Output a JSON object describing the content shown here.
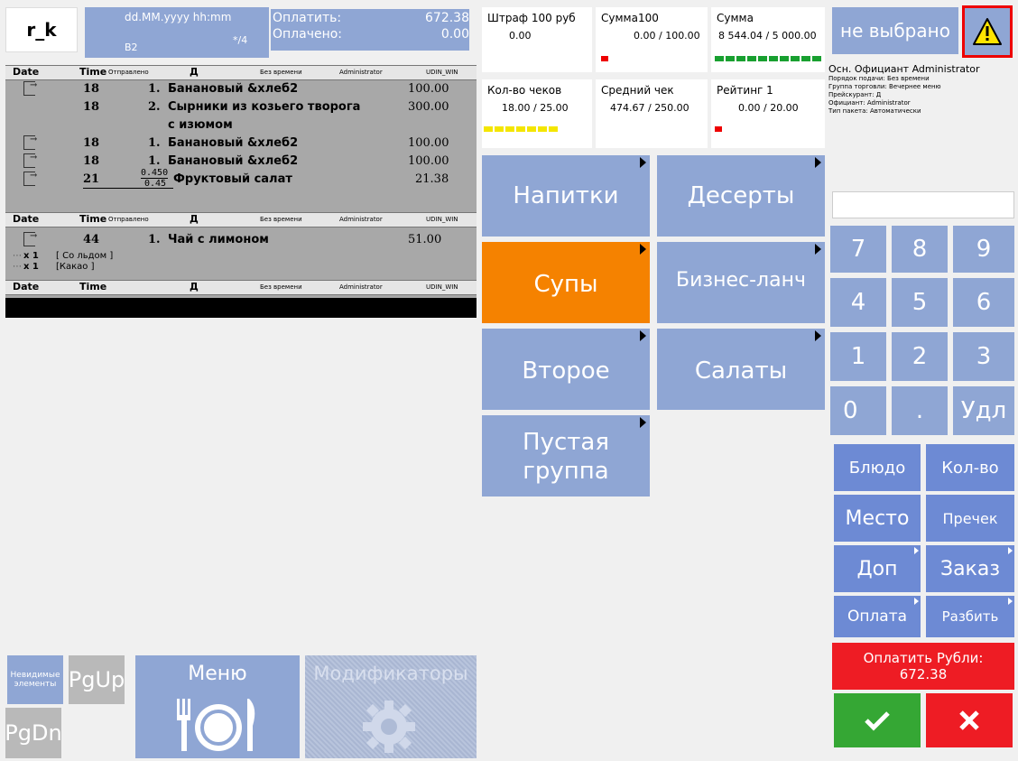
{
  "header": {
    "logo": "r_k",
    "date_format": "dd.MM.yyyy hh:mm",
    "table": "B2",
    "guests": "*/4",
    "pay_label": "Оплатить:",
    "pay_value": "672.38",
    "paid_label": "Оплачено:",
    "paid_value": "0.00"
  },
  "order": {
    "col_date": "Date",
    "col_time": "Time",
    "col_sent": "Отправлено",
    "col_d": "Д",
    "col_notime": "Без времени",
    "col_admin": "Administrator",
    "col_station": "UDIN_WIN",
    "lines": [
      {
        "time": "18",
        "num": "1.",
        "name": "Банановый &хлеб2",
        "price": "100.00"
      },
      {
        "time": "18",
        "num": "2.",
        "name": "Сырники из козьего творога",
        "price": "300.00"
      },
      {
        "name2": "с изюмом"
      },
      {
        "time": "18",
        "num": "1.",
        "name": "Банановый &хлеб2",
        "price": "100.00"
      },
      {
        "time": "18",
        "num": "1.",
        "name": "Банановый &хлеб2",
        "price": "100.00"
      },
      {
        "time": "21",
        "qty_top": "0.450",
        "qty_bot": "0.45",
        "name": "Фруктовый салат",
        "price": "21.38"
      },
      {
        "time": "44",
        "num": "1.",
        "name": "Чай с лимоном",
        "price": "51.00"
      }
    ],
    "modifiers": [
      {
        "qty": "x 1",
        "name": "[ Со льдом ]"
      },
      {
        "qty": "x 1",
        "name": "[Какао ]"
      }
    ]
  },
  "bottom_left": {
    "invisible": "Невидимые элементы",
    "pgup": "PgUp",
    "pgdn": "PgDn",
    "menu": "Меню",
    "modifiers": "Модификаторы"
  },
  "stats": [
    {
      "title": "Штраф 100 руб",
      "value": "0.00"
    },
    {
      "title": "Сумма100",
      "value": "0.00 / 100.00"
    },
    {
      "title": "Сумма",
      "value": "8 544.04 / 5 000.00"
    },
    {
      "title": "Кол-во чеков",
      "value": "18.00 / 25.00"
    },
    {
      "title": "Средний чек",
      "value": "474.67 / 250.00"
    },
    {
      "title": "Рейтинг 1",
      "value": "0.00 / 20.00"
    }
  ],
  "categories": [
    {
      "label": "Напитки"
    },
    {
      "label": "Десерты"
    },
    {
      "label": "Супы"
    },
    {
      "label": "Бизнес-ланч"
    },
    {
      "label": "Второе"
    },
    {
      "label": "Салаты"
    },
    {
      "label": "Пустая группа"
    }
  ],
  "right": {
    "waiter": "не выбрано",
    "info_main": "Осн. Официант  Administrator",
    "info_order": "Порядок подачи: Без времени",
    "info_group": "Группа торговли: Вечернее меню",
    "info_price": "Прейскурант: Д",
    "info_waiter": "Официант: Administrator",
    "info_pack": "Тип пакета: Автоматически",
    "keys": [
      "7",
      "8",
      "9",
      "4",
      "5",
      "6",
      "1",
      "2",
      "3",
      "0",
      ".",
      "Удл"
    ],
    "dish": "Блюдо",
    "qty": "Кол-во",
    "place": "Место",
    "precheck": "Пречек",
    "extra": "Доп",
    "order": "Заказ",
    "payment": "Оплата",
    "split": "Разбить",
    "pay_rub": "Оплатить Рубли:",
    "pay_rub_value": "672.38"
  },
  "colors": {
    "accent_blue": "#8fa6d4",
    "action_blue": "#6d8ad4",
    "orange": "#f58200",
    "red": "#ee1c24",
    "green": "#35a734"
  }
}
